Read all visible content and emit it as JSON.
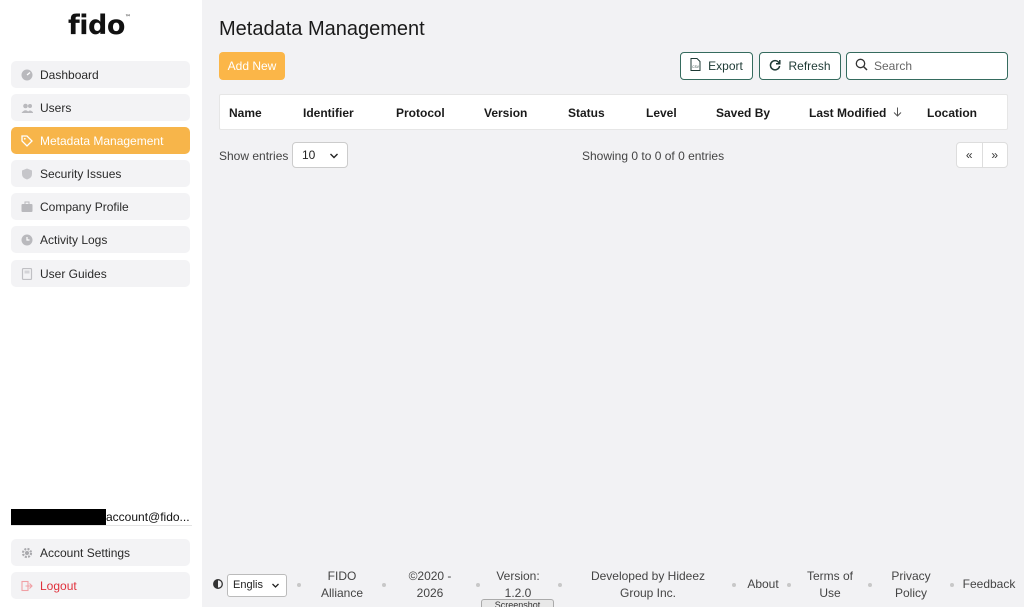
{
  "app": {
    "logo_text": "fido"
  },
  "sidebar": {
    "items": [
      {
        "label": "Dashboard",
        "icon": "dashboard-icon"
      },
      {
        "label": "Users",
        "icon": "users-icon"
      },
      {
        "label": "Metadata Management",
        "icon": "tag-icon",
        "active": true
      },
      {
        "label": "Security Issues",
        "icon": "shield-icon"
      },
      {
        "label": "Company Profile",
        "icon": "briefcase-icon"
      },
      {
        "label": "Activity Logs",
        "icon": "clock-icon"
      },
      {
        "label": "User Guides",
        "icon": "book-icon"
      }
    ],
    "account_email": "account@fido...",
    "account_settings": "Account Settings",
    "logout": "Logout"
  },
  "main": {
    "title": "Metadata Management",
    "add_new": "Add New",
    "export": "Export",
    "refresh": "Refresh",
    "search_placeholder": "Search",
    "columns": [
      "Name",
      "Identifier",
      "Protocol",
      "Version",
      "Status",
      "Level",
      "Saved By",
      "Last Modified",
      "Location"
    ],
    "show_entries_label": "Show entries",
    "page_size": "10",
    "info": "Showing 0 to 0 of 0 entries",
    "prev": "«",
    "next": "»"
  },
  "footer": {
    "language": "Englis",
    "links": [
      "FIDO Alliance",
      "©2020 - 2026",
      "Version: 1.2.0",
      "Developed by Hideez Group Inc.",
      "About",
      "Terms of Use",
      "Privacy Policy",
      "Feedback"
    ],
    "tooltip": "Screenshot"
  },
  "colors": {
    "accent": "#f7b54a",
    "outline": "#356b5e",
    "danger": "#e0313c"
  }
}
